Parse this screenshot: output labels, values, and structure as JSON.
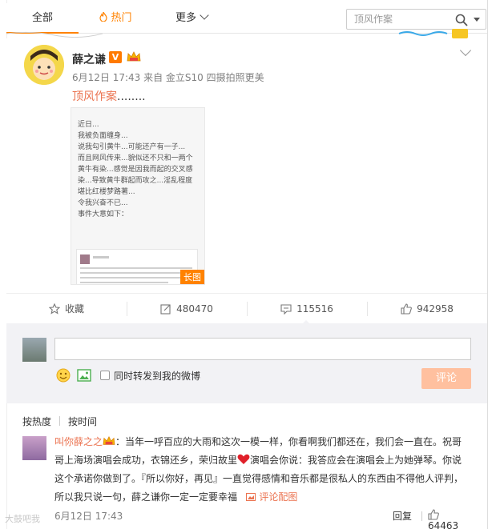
{
  "tabs": {
    "all": "全部",
    "hot": "热门",
    "more": "更多"
  },
  "search": {
    "placeholder": "顶风作案"
  },
  "post": {
    "author": "薛之谦",
    "verified_badge": "V",
    "meta": "6月12日 17:43 来自 金立S10 四摄拍照更美",
    "topic": "顶风作案",
    "text_suffix": "........",
    "image_tag": "长图",
    "image_lines": [
      "近日...",
      "我被负面缠身...",
      "说我勾引黄牛...可能还产有一子...",
      "而且网风传来...貌似还不只和一两个",
      "黄牛有染...感觉是因我而起的交叉感",
      "染...导致黄牛群起而攻之...淫乱程度",
      "堪比红楼梦路著...",
      "令我兴奋不已...",
      "",
      "事件大意如下："
    ]
  },
  "actions": {
    "favorite": "收藏",
    "forward_count": "480470",
    "comment_count": "115516",
    "like_count": "942958"
  },
  "composer": {
    "forward_label": "同时转发到我的微博",
    "submit_label": "评论"
  },
  "sort": {
    "by_hot": "按热度",
    "by_time": "按时间"
  },
  "comment": {
    "user": "叫你薛之之",
    "text_part1": "：当年一呼百应的大雨和这次一模一样，你看啊我们都还在，我们会一直在。祝哥哥上海场演唱会成功，衣锦还乡，荣归故里",
    "text_part2": "演唱会你说：我答应会在演唱会上为她弹琴。你说这个承诺你做到了。『所以你好，再见』一直觉得感情和音乐都是很私人的东西由不得他人评判，所以我只说一句，薛之谦你一定一定要幸福",
    "image_link": "评论配图",
    "time": "6月12日 17:43",
    "reply_label": "回复",
    "like_count": "64463"
  },
  "watermark": "大鼓吧我",
  "colors": {
    "accent_orange": "#ff8200",
    "link_orange": "#eb7350",
    "submit_disabled": "#ffc09f"
  }
}
